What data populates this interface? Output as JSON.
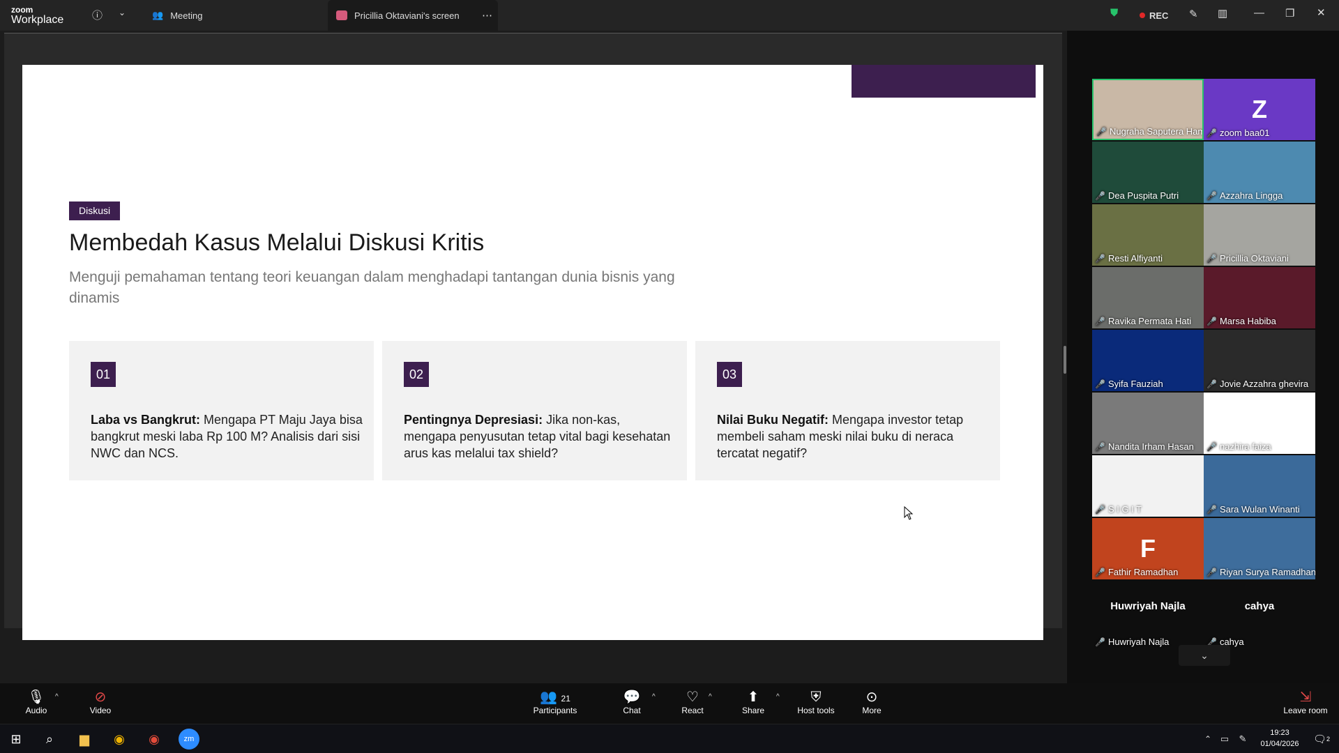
{
  "app": {
    "brand_small": "zoom",
    "brand_big": "Workplace"
  },
  "titlebar": {
    "meeting_label": "Meeting",
    "share_tab_label": "Pricillia Oktaviani's screen",
    "rec_label": "REC"
  },
  "slide": {
    "badge": "Diskusi",
    "title": "Membedah Kasus Melalui Diskusi Kritis",
    "subtitle": "Menguji pemahaman tentang teori keuangan dalam menghadapi tantangan dunia bisnis yang dinamis",
    "cards": [
      {
        "num": "01",
        "bold": "Laba vs Bangkrut:",
        "text": " Mengapa PT Maju Jaya bisa bangkrut meski laba Rp 100 M? Analisis dari sisi NWC dan NCS."
      },
      {
        "num": "02",
        "bold": "Pentingnya Depresiasi:",
        "text": " Jika non-kas, mengapa penyusutan tetap vital bagi kesehatan arus kas melalui tax shield?"
      },
      {
        "num": "03",
        "bold": "Nilai Buku Negatif:",
        "text": " Mengapa investor tetap membeli saham meski nilai buku di neraca tercatat negatif?"
      }
    ]
  },
  "participants_gallery": [
    {
      "name": "Nugraha Saputera Ham...",
      "color": "#c9b8a6"
    },
    {
      "name": "zoom baa01",
      "color": "#6a39c5",
      "initial": "Z"
    },
    {
      "name": "Dea Puspita Putri",
      "color": "#1f4b3a"
    },
    {
      "name": "Azzahra Lingga",
      "color": "#4d8ab0"
    },
    {
      "name": "Resti Alfiyanti",
      "color": "#6a7044"
    },
    {
      "name": "Pricillia Oktaviani",
      "color": "#a5a5a0"
    },
    {
      "name": "Ravika Permata Hati",
      "color": "#6b6d6a"
    },
    {
      "name": "Marsa Habiba",
      "color": "#5a1a2a"
    },
    {
      "name": "Syifa Fauziah",
      "color": "#0a2a7a"
    },
    {
      "name": "Jovie Azzahra ghevira",
      "color": "#2a2a2a"
    },
    {
      "name": "Nandita Irham Hasan",
      "color": "#7a7a7a"
    },
    {
      "name": "nazhira faiza",
      "color": "#ffffff"
    },
    {
      "name": "S I G I T",
      "color": "#f2f2f2"
    },
    {
      "name": "Sara Wulan Winanti",
      "color": "#3b6a9a"
    },
    {
      "name": "Fathir Ramadhan",
      "color": "#c1441e",
      "initial": "F"
    },
    {
      "name": "Riyan Surya Ramadhan",
      "color": "#3e6d9c"
    },
    {
      "name": "cahya",
      "color": "#1a1a1a",
      "big": "cahya"
    },
    {
      "name": "Huwriyah Najla",
      "color": "#1a1a1a",
      "big": "Huwriyah Najla"
    }
  ],
  "toolbar": {
    "audio": "Audio",
    "video": "Video",
    "participants": "Participants",
    "participants_count": "21",
    "chat": "Chat",
    "react": "React",
    "share": "Share",
    "host_tools": "Host tools",
    "more": "More",
    "leave": "Leave room"
  },
  "taskbar": {
    "time": "19:23",
    "date": "01/04/2026",
    "notif_count": "2"
  },
  "colors": {
    "accent_purple": "#3d1f4f",
    "zoom_blue": "#2d8cff",
    "rec_red": "#e02828"
  }
}
